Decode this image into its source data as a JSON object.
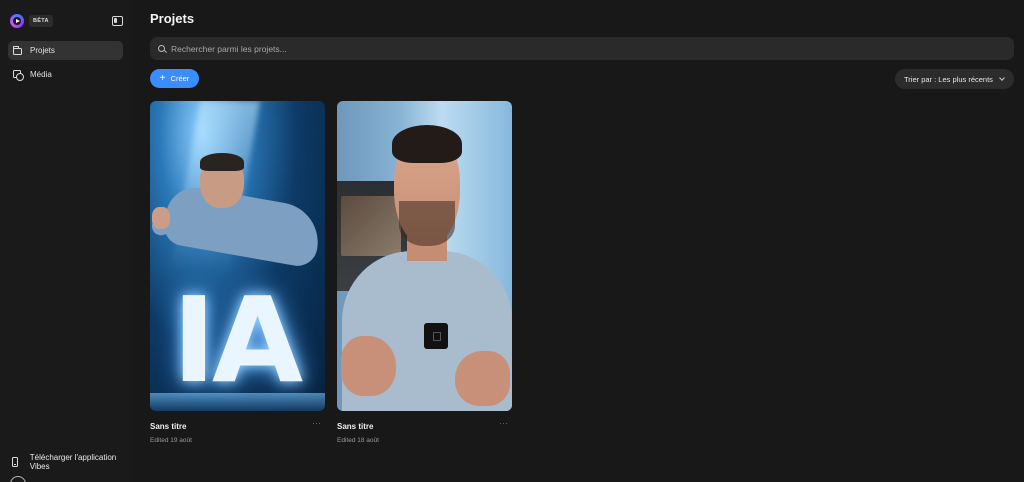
{
  "sidebar": {
    "badge": "BÊTA",
    "items": [
      {
        "label": "Projets",
        "icon": "folder-icon",
        "active": true
      },
      {
        "label": "Média",
        "icon": "media-icon",
        "active": false
      }
    ],
    "download_label": "Télécharger l'application Vibes"
  },
  "main": {
    "title": "Projets",
    "search_placeholder": "Rechercher parmi les projets...",
    "create_label": "Créer",
    "sort_label": "Trier par : Les plus récents",
    "projects": [
      {
        "title": "Sans titre",
        "date": "Edited 19 août",
        "more": "···"
      },
      {
        "title": "Sans titre",
        "date": "Edited 18 août",
        "more": "···"
      }
    ]
  },
  "colors": {
    "background": "#181818",
    "accent": "#3a8dff",
    "surface": "#2a2a2a"
  }
}
